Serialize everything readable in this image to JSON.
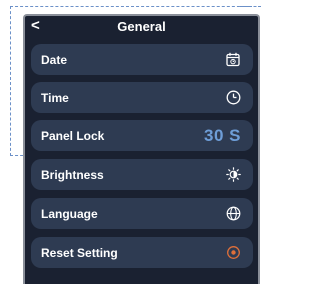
{
  "header": {
    "title": "General",
    "back_glyph": "<"
  },
  "rows": [
    {
      "label": "Date",
      "icon": "calendar-icon"
    },
    {
      "label": "Time",
      "icon": "clock-icon"
    },
    {
      "label": "Panel Lock",
      "value": "30 S"
    },
    {
      "label": "Brightness",
      "icon": "brightness-icon"
    },
    {
      "label": "Language",
      "icon": "globe-icon"
    },
    {
      "label": "Reset Setting",
      "icon": "reset-icon"
    }
  ],
  "colors": {
    "background": "#1a2131",
    "row": "#2e3b52",
    "accent_blue": "#6e9ed8",
    "reset_orange": "#e0703a",
    "guide_dash": "#6b90c8"
  }
}
